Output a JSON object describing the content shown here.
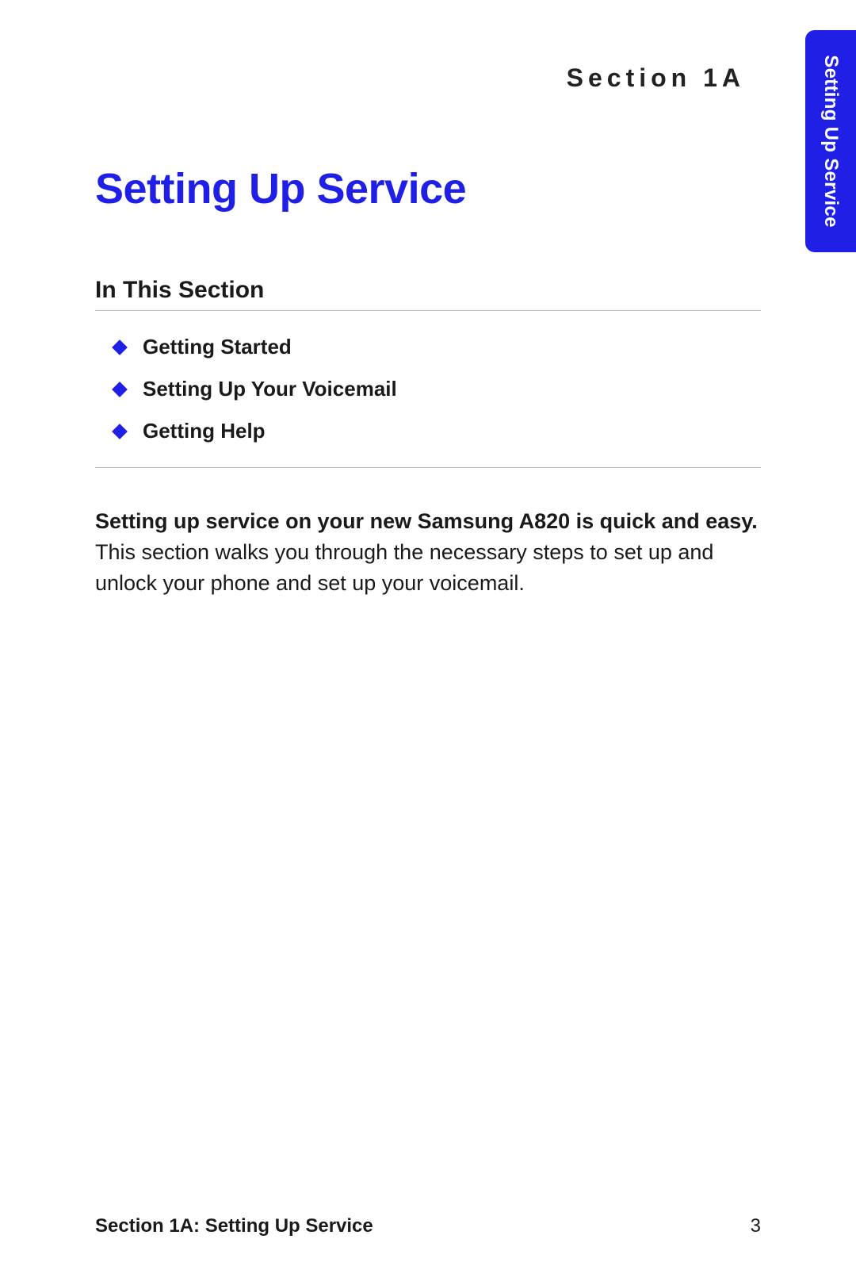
{
  "sectionLabel": "Section 1A",
  "heading": "Setting Up Service",
  "subheading": "In This Section",
  "toc": {
    "items": [
      {
        "label": "Getting Started"
      },
      {
        "label": "Setting Up Your Voicemail"
      },
      {
        "label": "Getting Help"
      }
    ]
  },
  "body": {
    "bold": "Setting up service on your new Samsung A820 is quick and easy.",
    "rest": " This section walks you through the necessary steps to set up and unlock your phone and set up your voicemail."
  },
  "footer": {
    "left": "Section 1A: Setting Up Service",
    "right": "3"
  },
  "sideTab": {
    "label": "Setting Up Service"
  }
}
